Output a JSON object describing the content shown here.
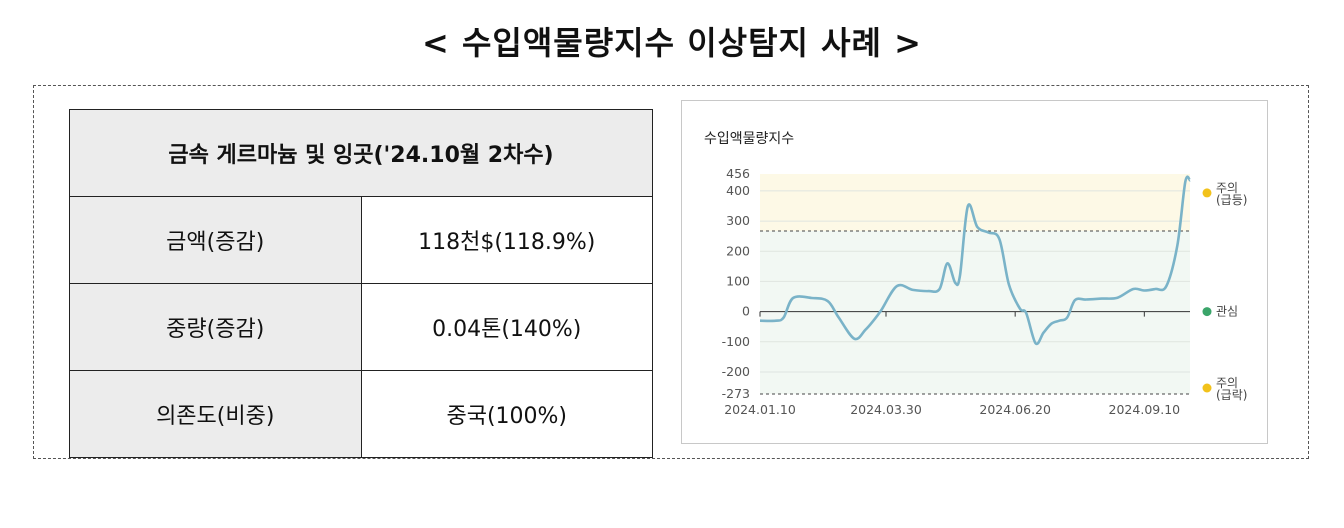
{
  "page": {
    "title": "< 수입액물량지수 이상탐지 사례 >"
  },
  "table": {
    "header": "금속 게르마늄 및 잉곳('24.10월 2차수)",
    "rows": [
      {
        "label": "금액(증감)",
        "value": "118천$(118.9%)"
      },
      {
        "label": "중량(증감)",
        "value": "0.04톤(140%)"
      },
      {
        "label": "의존도(비중)",
        "value": "중국(100%)"
      }
    ]
  },
  "chart_data": {
    "type": "line",
    "title": "수입액물량지수",
    "y_ticks": [
      "456",
      "400",
      "300",
      "200",
      "100",
      "0",
      "-100",
      "-200",
      "-273"
    ],
    "x_ticks": [
      "2024.01.10",
      "2024.03.30",
      "2024.06.20",
      "2024.09.10"
    ],
    "ylim": [
      -273,
      456
    ],
    "thresholds": {
      "upper": 267,
      "lower": -273
    },
    "bands": [
      {
        "label": "주의\n(급등)",
        "color": "#f2c21b"
      },
      {
        "label": "관심",
        "color": "#3aa56a"
      },
      {
        "label": "주의\n(급락)",
        "color": "#f2c21b"
      }
    ],
    "x": [
      "2024-01-10",
      "2024-01-20",
      "2024-01-25",
      "2024-01-31",
      "2024-02-12",
      "2024-02-22",
      "2024-02-29",
      "2024-03-10",
      "2024-03-17",
      "2024-03-22",
      "2024-03-27",
      "2024-04-06",
      "2024-04-16",
      "2024-04-26",
      "2024-05-03",
      "2024-05-08",
      "2024-05-13",
      "2024-05-16",
      "2024-05-21",
      "2024-05-27",
      "2024-06-03",
      "2024-06-10",
      "2024-06-16",
      "2024-06-23",
      "2024-06-27",
      "2024-07-03",
      "2024-07-08",
      "2024-07-13",
      "2024-07-18",
      "2024-07-23",
      "2024-07-28",
      "2024-08-04",
      "2024-08-14",
      "2024-08-24",
      "2024-09-03",
      "2024-09-10",
      "2024-09-17",
      "2024-09-24",
      "2024-10-01",
      "2024-10-06",
      "2024-10-09"
    ],
    "values": [
      -30,
      -30,
      -20,
      45,
      45,
      35,
      -20,
      -90,
      -60,
      -30,
      5,
      85,
      72,
      68,
      75,
      160,
      95,
      120,
      350,
      280,
      262,
      240,
      90,
      10,
      -5,
      -105,
      -70,
      -40,
      -30,
      -20,
      38,
      40,
      43,
      46,
      75,
      70,
      75,
      85,
      220,
      430,
      435
    ],
    "colors": {
      "line": "#7ab3c8",
      "upper_zone": "#fdf9e6",
      "normal_zone": "#f2f8f3"
    }
  }
}
